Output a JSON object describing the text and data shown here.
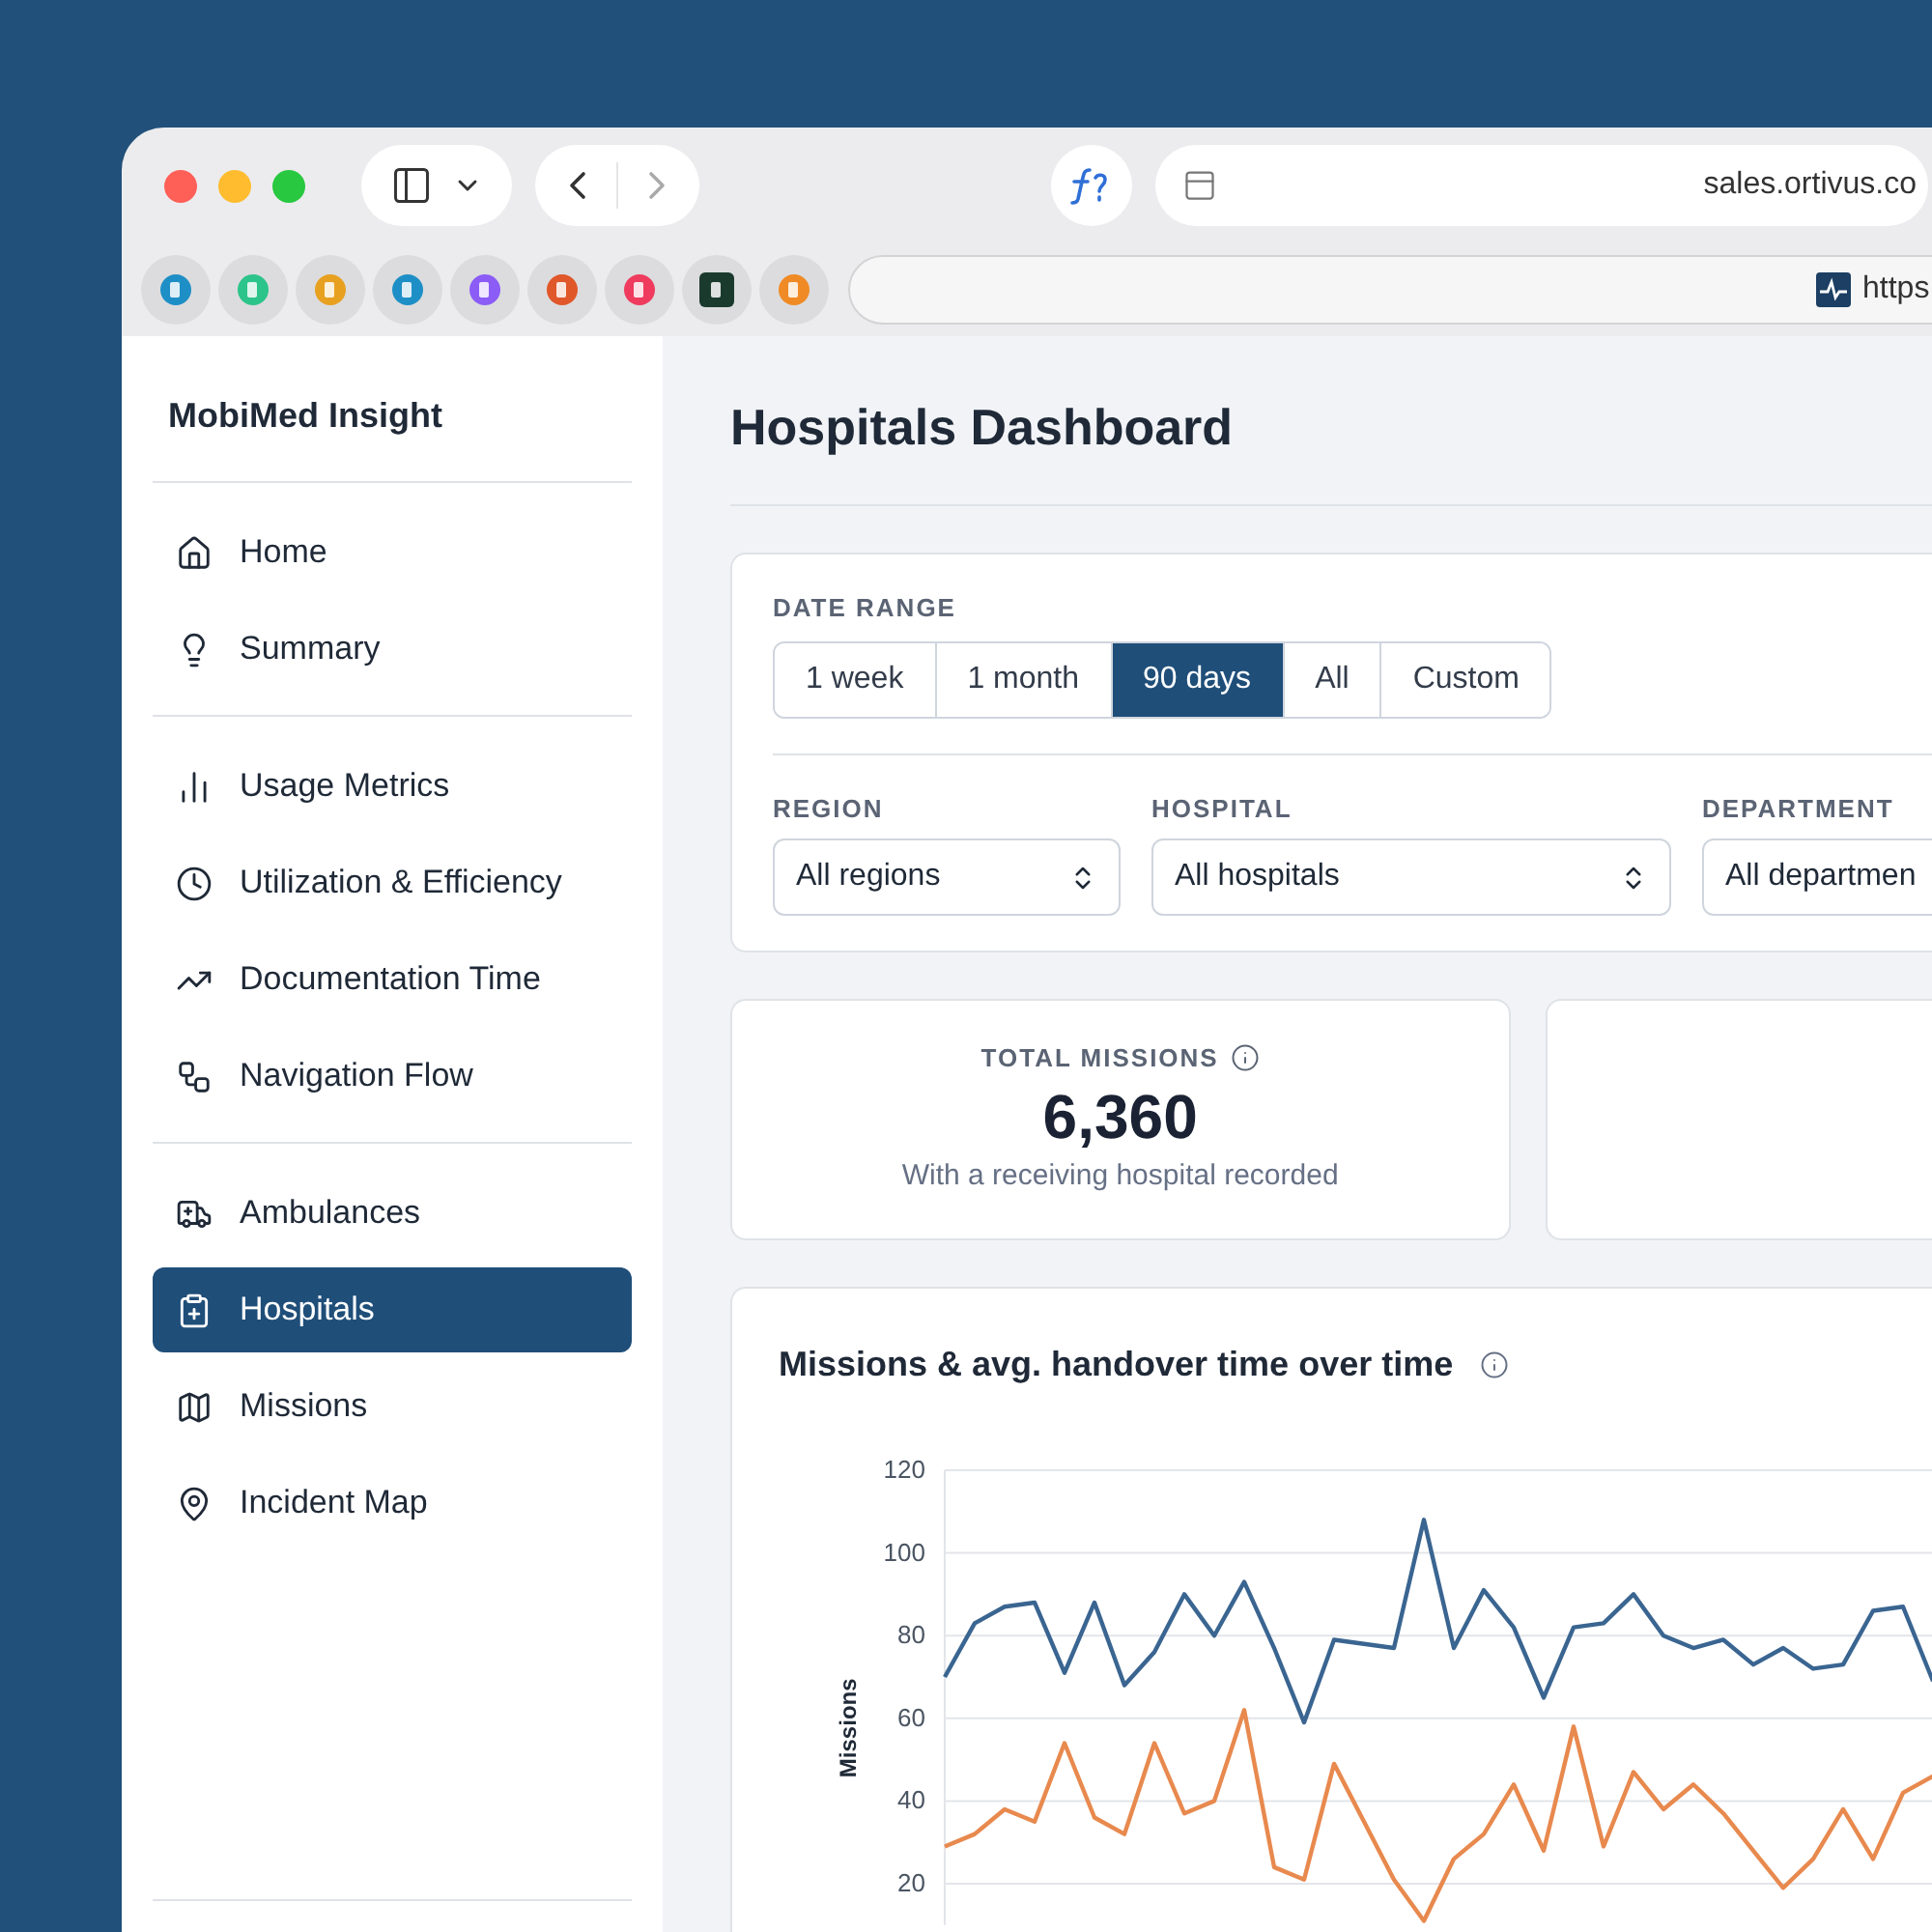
{
  "browser": {
    "address_bar": {
      "text": "sales.ortivus.co"
    },
    "second_bar": {
      "text": "https"
    }
  },
  "sidebar": {
    "title": "MobiMed Insight",
    "groups": [
      {
        "items": [
          {
            "label": "Home",
            "selected": false
          },
          {
            "label": "Summary",
            "selected": false
          }
        ]
      },
      {
        "items": [
          {
            "label": "Usage Metrics",
            "selected": false
          },
          {
            "label": "Utilization & Efficiency",
            "selected": false
          },
          {
            "label": "Documentation Time",
            "selected": false
          },
          {
            "label": "Navigation Flow",
            "selected": false
          }
        ]
      },
      {
        "items": [
          {
            "label": "Ambulances",
            "selected": false
          },
          {
            "label": "Hospitals",
            "selected": true
          },
          {
            "label": "Missions",
            "selected": false
          },
          {
            "label": "Incident Map",
            "selected": false
          }
        ]
      }
    ]
  },
  "page": {
    "title": "Hospitals Dashboard"
  },
  "date_range": {
    "label": "DATE RANGE",
    "options": [
      {
        "label": "1 week",
        "selected": false
      },
      {
        "label": "1 month",
        "selected": false
      },
      {
        "label": "90 days",
        "selected": true
      },
      {
        "label": "All",
        "selected": false
      },
      {
        "label": "Custom",
        "selected": false
      }
    ]
  },
  "filters": [
    {
      "label": "REGION",
      "value": "All regions"
    },
    {
      "label": "HOSPITAL",
      "value": "All hospitals"
    },
    {
      "label": "DEPARTMENT",
      "value": "All departmen"
    }
  ],
  "kpis": [
    {
      "label": "TOTAL MISSIONS",
      "value": "6,360",
      "caption": "With a receiving hospital recorded"
    }
  ],
  "chart": {
    "title": "Missions & avg. handover time over time",
    "chart_data": {
      "type": "line",
      "ylabel": "Missions",
      "yticks": [
        20,
        40,
        60,
        80,
        100,
        120
      ],
      "ylim": [
        10,
        120
      ],
      "grid": true,
      "series": [
        {
          "color": "#3a6591",
          "values": [
            70,
            83,
            87,
            88,
            71,
            88,
            68,
            76,
            90,
            80,
            93,
            77,
            59,
            79,
            78,
            77,
            108,
            77,
            91,
            82,
            65,
            82,
            83,
            90,
            80,
            77,
            79,
            73,
            77,
            72,
            73,
            86,
            87,
            69
          ]
        },
        {
          "color": "#e8894e",
          "values": [
            29,
            32,
            38,
            35,
            54,
            36,
            32,
            54,
            37,
            40,
            62,
            24,
            21,
            49,
            35,
            21,
            11,
            26,
            32,
            44,
            28,
            58,
            29,
            47,
            38,
            44,
            37,
            28,
            19,
            26,
            38,
            26,
            42,
            46
          ]
        }
      ]
    }
  }
}
